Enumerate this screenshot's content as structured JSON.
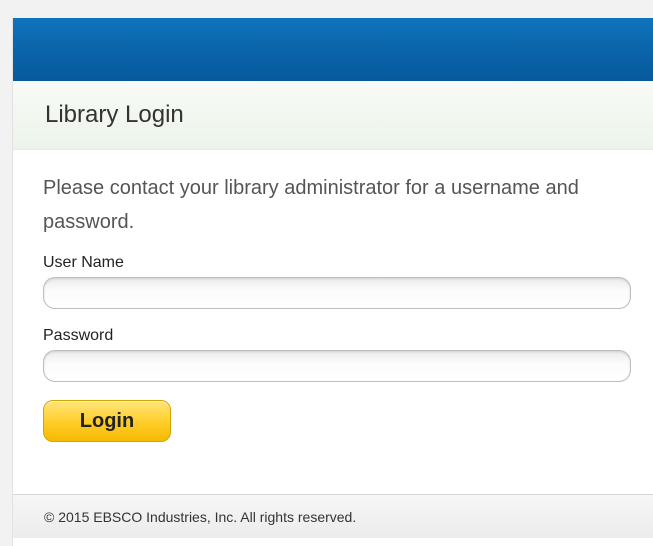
{
  "header": {
    "title": "Library Login"
  },
  "colors": {
    "topbar": "#0a63a8",
    "header_bg": "#ecf4ea",
    "login_button": "#ffcf2d"
  },
  "form": {
    "intro": "Please contact your library administrator for a username and password.",
    "username": {
      "label": "User Name",
      "value": "",
      "placeholder": ""
    },
    "password": {
      "label": "Password",
      "value": "",
      "placeholder": ""
    },
    "submit_label": "Login"
  },
  "footer": {
    "copyright": "© 2015 EBSCO Industries, Inc. All rights reserved."
  }
}
